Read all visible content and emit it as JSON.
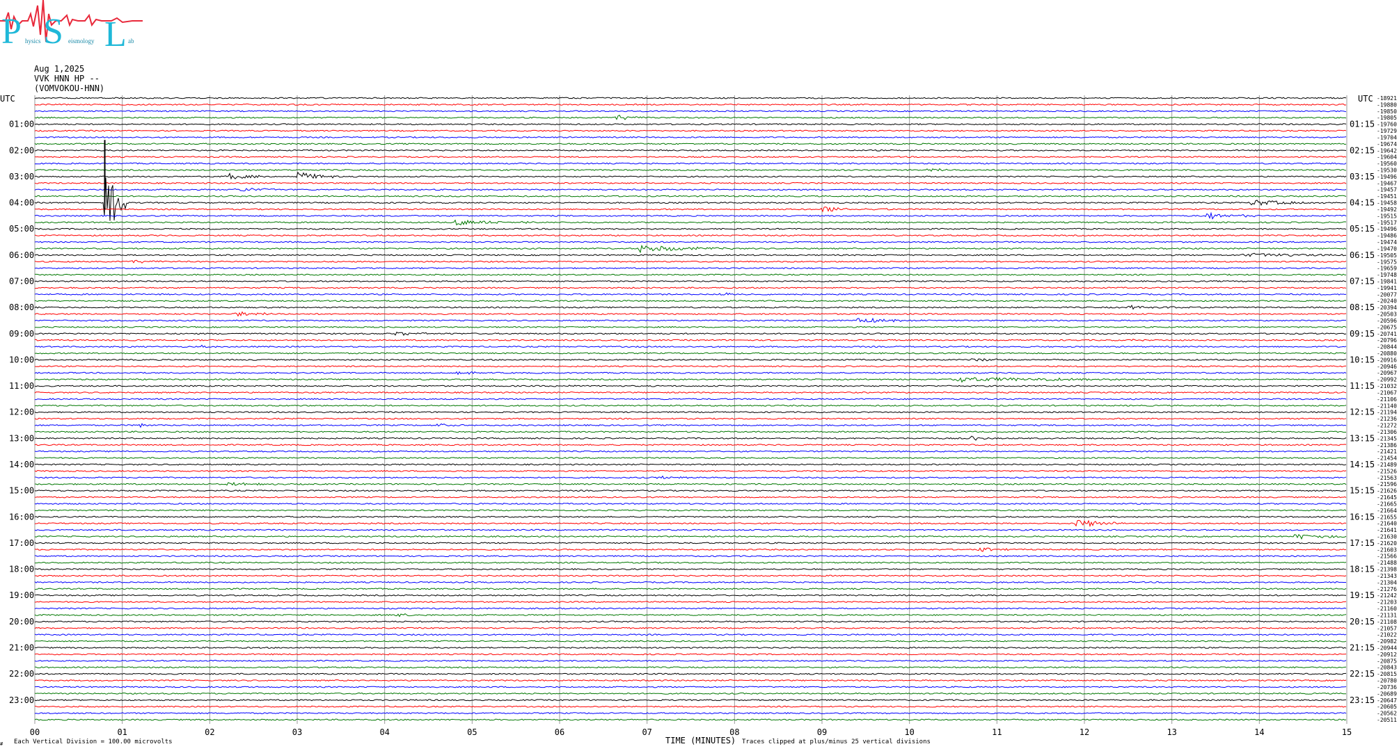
{
  "logo": {
    "big_letters": [
      "P",
      "S",
      "L"
    ],
    "small_words": [
      "hysics",
      "eismology",
      "ab"
    ],
    "color": "#1fb8d8"
  },
  "header": {
    "date": "Aug 1,2025",
    "station": "VVK HNN HP --",
    "channel": "(VOMVOKOU-HNN)"
  },
  "labels": {
    "utc_left": "UTC",
    "utc_right": "UTC",
    "x_axis_title": "TIME (MINUTES)",
    "scale_note": "Each Vertical Division =  100.00 microvolts",
    "clip_note": "Traces clipped at plus/minus 25 vertical divisions",
    "corner_mark": "#"
  },
  "colors": {
    "trace_cycle": [
      "#000000",
      "#ff0000",
      "#0000ff",
      "#007700"
    ],
    "grid": "#9a9a9a"
  },
  "chart_data": {
    "type": "helicorder",
    "x_ticks": [
      "00",
      "01",
      "02",
      "03",
      "04",
      "05",
      "06",
      "07",
      "08",
      "09",
      "10",
      "11",
      "12",
      "13",
      "14",
      "15"
    ],
    "xlim": [
      0,
      15
    ],
    "minutes_per_trace": 15,
    "left_time_labels": [
      "01:00",
      "02:00",
      "03:00",
      "04:00",
      "05:00",
      "06:00",
      "07:00",
      "08:00",
      "09:00",
      "10:00",
      "11:00",
      "12:00",
      "13:00",
      "14:00",
      "15:00",
      "16:00",
      "17:00",
      "18:00",
      "19:00",
      "20:00",
      "21:00",
      "22:00",
      "23:00"
    ],
    "right_time_labels": [
      "01:15",
      "02:15",
      "03:15",
      "04:15",
      "05:15",
      "06:15",
      "07:15",
      "08:15",
      "09:15",
      "10:15",
      "11:15",
      "12:15",
      "13:15",
      "14:15",
      "15:15",
      "16:15",
      "17:15",
      "18:15",
      "19:15",
      "20:15",
      "21:15",
      "22:15",
      "23:15"
    ],
    "trace_offsets": [
      "-18921",
      "-19880",
      "-19850",
      "-19805",
      "-19760",
      "-19729",
      "-19704",
      "-19674",
      "-19642",
      "-19604",
      "-19560",
      "-19530",
      "-19496",
      "-19467",
      "-19457",
      "-19451",
      "-19458",
      "-19492",
      "-19515",
      "-19517",
      "-19496",
      "-19486",
      "-19474",
      "-19470",
      "-19505",
      "-19575",
      "-19659",
      "-19748",
      "-19841",
      "-19941",
      "-20077",
      "-20240",
      "-20394",
      "-20503",
      "-20596",
      "-20675",
      "-20741",
      "-20796",
      "-20844",
      "-20880",
      "-20916",
      "-20946",
      "-20967",
      "-20992",
      "-21032",
      "-21067",
      "-21106",
      "-21140",
      "-21194",
      "-21236",
      "-21272",
      "-21306",
      "-21345",
      "-21386",
      "-21421",
      "-21454",
      "-21489",
      "-21526",
      "-21563",
      "-21596",
      "-21626",
      "-21645",
      "-21665",
      "-21664",
      "-21655",
      "-21640",
      "-21641",
      "-21630",
      "-21620",
      "-21603",
      "-21566",
      "-21488",
      "-21398",
      "-21343",
      "-21304",
      "-21276",
      "-21242",
      "-21203",
      "-21160",
      "-21131",
      "-21108",
      "-21057",
      "-21022",
      "-20982",
      "-20944",
      "-20912",
      "-20875",
      "-20843",
      "-20815",
      "-20780",
      "-20736",
      "-20689",
      "-20647",
      "-20605",
      "-20562",
      "-20511"
    ],
    "events": [
      {
        "trace": 3,
        "minute": 6.65,
        "amp": 0.5,
        "dur": 0.4
      },
      {
        "trace": 11,
        "minute": 10.2,
        "amp": 0.3,
        "dur": 0.4
      },
      {
        "trace": 12,
        "minute": 2.2,
        "amp": 0.6,
        "dur": 0.5
      },
      {
        "trace": 12,
        "minute": 3.0,
        "amp": 0.8,
        "dur": 0.5
      },
      {
        "trace": 14,
        "minute": 2.3,
        "amp": 0.4,
        "dur": 0.6
      },
      {
        "trace": 16,
        "minute": 0.8,
        "amp": 8.0,
        "dur": 0.25
      },
      {
        "trace": 16,
        "minute": 13.9,
        "amp": 0.5,
        "dur": 0.9
      },
      {
        "trace": 17,
        "minute": 9.0,
        "amp": 0.5,
        "dur": 0.8
      },
      {
        "trace": 18,
        "minute": 13.4,
        "amp": 0.6,
        "dur": 0.6
      },
      {
        "trace": 19,
        "minute": 4.8,
        "amp": 0.45,
        "dur": 1.0
      },
      {
        "trace": 23,
        "minute": 6.9,
        "amp": 0.6,
        "dur": 1.1
      },
      {
        "trace": 24,
        "minute": 13.8,
        "amp": 0.3,
        "dur": 1.5
      },
      {
        "trace": 25,
        "minute": 1.1,
        "amp": 0.3,
        "dur": 0.6
      },
      {
        "trace": 30,
        "minute": 7.8,
        "amp": 0.2,
        "dur": 0.8
      },
      {
        "trace": 32,
        "minute": 12.5,
        "amp": 0.3,
        "dur": 1.0
      },
      {
        "trace": 33,
        "minute": 2.3,
        "amp": 0.4,
        "dur": 0.6
      },
      {
        "trace": 34,
        "minute": 9.4,
        "amp": 0.4,
        "dur": 0.8
      },
      {
        "trace": 36,
        "minute": 4.1,
        "amp": 0.25,
        "dur": 0.7
      },
      {
        "trace": 37,
        "minute": 12.55,
        "amp": 0.4,
        "dur": 0.15
      },
      {
        "trace": 38,
        "minute": 1.9,
        "amp": 0.3,
        "dur": 0.3
      },
      {
        "trace": 40,
        "minute": 10.7,
        "amp": 0.25,
        "dur": 0.6
      },
      {
        "trace": 42,
        "minute": 4.8,
        "amp": 0.4,
        "dur": 0.3
      },
      {
        "trace": 43,
        "minute": 10.5,
        "amp": 0.35,
        "dur": 3.0
      },
      {
        "trace": 44,
        "minute": 5.9,
        "amp": 0.25,
        "dur": 0.4
      },
      {
        "trace": 50,
        "minute": 1.2,
        "amp": 0.5,
        "dur": 0.15
      },
      {
        "trace": 50,
        "minute": 4.6,
        "amp": 0.3,
        "dur": 0.3
      },
      {
        "trace": 52,
        "minute": 10.7,
        "amp": 0.5,
        "dur": 0.2
      },
      {
        "trace": 58,
        "minute": 7.1,
        "amp": 0.3,
        "dur": 0.6
      },
      {
        "trace": 59,
        "minute": 2.2,
        "amp": 0.3,
        "dur": 0.6
      },
      {
        "trace": 65,
        "minute": 11.9,
        "amp": 0.7,
        "dur": 0.6
      },
      {
        "trace": 67,
        "minute": 14.4,
        "amp": 0.4,
        "dur": 0.8
      },
      {
        "trace": 69,
        "minute": 10.8,
        "amp": 0.35,
        "dur": 0.4
      },
      {
        "trace": 79,
        "minute": 4.1,
        "amp": 0.25,
        "dur": 0.5
      }
    ]
  }
}
